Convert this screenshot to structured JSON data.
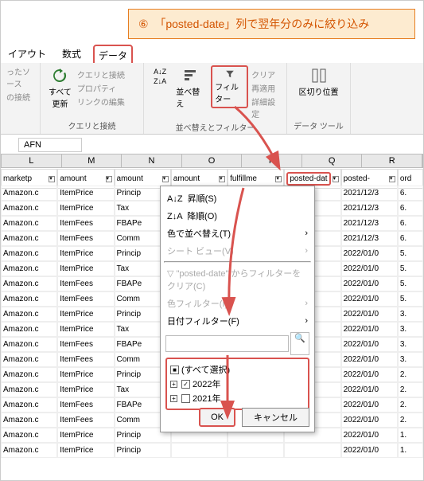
{
  "callout": {
    "num": "⑥",
    "text": "「posted-date」列で翌年分のみに絞り込み"
  },
  "tabs": {
    "layout": "イアウト",
    "formula": "数式",
    "data": "データ"
  },
  "ribbon": {
    "refresh": "すべて\n更新",
    "queryConn": "クエリと接続",
    "props": "プロパティ",
    "editLinks": "リンクの編集",
    "groupQC": "クエリと接続",
    "sort": "並べ替え",
    "filter": "フィルター",
    "clear": "クリア",
    "reapply": "再適用",
    "advanced": "詳細設定",
    "groupSort": "並べ替えとフィルター",
    "textToCols": "区切り位置",
    "groupData": "データ ツール",
    "connSource": "ったソース",
    "connConn": "の接続"
  },
  "namebox": "AFN",
  "cols": [
    "L",
    "M",
    "N",
    "O",
    "P",
    "Q",
    "R"
  ],
  "headers": [
    "marketp",
    "amount",
    "amount",
    "amount",
    "fulfillme",
    "posted-dat",
    "posted-",
    "ord"
  ],
  "rows": [
    [
      "Amazon.c",
      "ItemPrice",
      "Princip",
      "",
      "",
      "",
      "2021/12/3",
      "6."
    ],
    [
      "Amazon.c",
      "ItemPrice",
      "Tax",
      "",
      "",
      "",
      "2021/12/3",
      "6."
    ],
    [
      "Amazon.c",
      "ItemFees",
      "FBAPe",
      "",
      "",
      "",
      "2021/12/3",
      "6."
    ],
    [
      "Amazon.c",
      "ItemFees",
      "Comm",
      "",
      "",
      "",
      "2021/12/3",
      "6."
    ],
    [
      "Amazon.c",
      "ItemPrice",
      "Princip",
      "",
      "",
      "",
      "2022/01/0",
      "5."
    ],
    [
      "Amazon.c",
      "ItemPrice",
      "Tax",
      "",
      "",
      "",
      "2022/01/0",
      "5."
    ],
    [
      "Amazon.c",
      "ItemFees",
      "FBAPe",
      "",
      "",
      "",
      "2022/01/0",
      "5."
    ],
    [
      "Amazon.c",
      "ItemFees",
      "Comm",
      "",
      "",
      "",
      "2022/01/0",
      "5."
    ],
    [
      "Amazon.c",
      "ItemPrice",
      "Princip",
      "",
      "",
      "",
      "2022/01/0",
      "3."
    ],
    [
      "Amazon.c",
      "ItemPrice",
      "Tax",
      "",
      "",
      "",
      "2022/01/0",
      "3."
    ],
    [
      "Amazon.c",
      "ItemFees",
      "FBAPe",
      "",
      "",
      "",
      "2022/01/0",
      "3."
    ],
    [
      "Amazon.c",
      "ItemFees",
      "Comm",
      "",
      "",
      "",
      "2022/01/0",
      "3."
    ],
    [
      "Amazon.c",
      "ItemPrice",
      "Princip",
      "",
      "",
      "",
      "2022/01/0",
      "2."
    ],
    [
      "Amazon.c",
      "ItemPrice",
      "Tax",
      "",
      "",
      "",
      "2022/01/0",
      "2."
    ],
    [
      "Amazon.c",
      "ItemFees",
      "FBAPe",
      "",
      "",
      "",
      "2022/01/0",
      "2."
    ],
    [
      "Amazon.c",
      "ItemFees",
      "Comm",
      "",
      "",
      "",
      "2022/01/0",
      "2."
    ],
    [
      "Amazon.c",
      "ItemPrice",
      "Princip",
      "",
      "",
      "",
      "2022/01/0",
      "1."
    ],
    [
      "Amazon.c",
      "ItemPrice",
      "Princip",
      "",
      "",
      "",
      "2022/01/0",
      "1."
    ]
  ],
  "menu": {
    "asc": "昇順(S)",
    "desc": "降順(O)",
    "sortColor": "色で並べ替え(T)",
    "sheetView": "シート ビュー(V)",
    "clearFilter": "\"posted-date\" からフィルターをクリア(C)",
    "colorFilter": "色フィルター(I)",
    "dateFilter": "日付フィルター(F)",
    "selectAll": "(すべて選択)",
    "y2022": "2022年",
    "y2021": "2021年",
    "ok": "OK",
    "cancel": "キャンセル",
    "searchPlaceholder": ""
  }
}
